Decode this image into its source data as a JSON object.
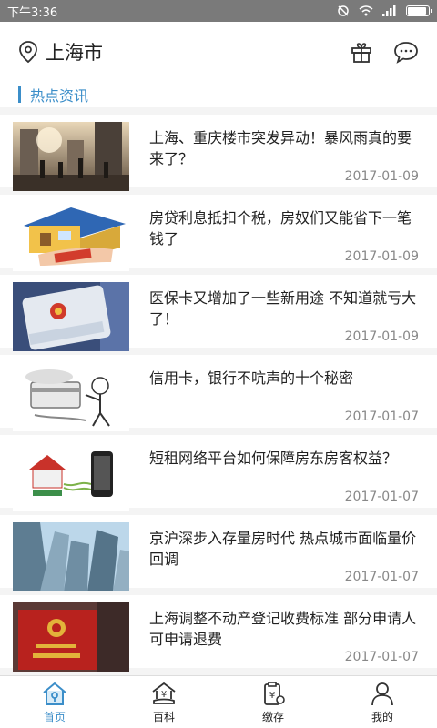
{
  "status": {
    "time": "下午3:36"
  },
  "header": {
    "city": "上海市"
  },
  "section": {
    "title": "热点资讯"
  },
  "news": [
    {
      "title": "上海、重庆楼市突发异动！暴风雨真的要来了？",
      "date": "2017-01-09"
    },
    {
      "title": "房贷利息抵扣个税，房奴们又能省下一笔钱了",
      "date": "2017-01-09"
    },
    {
      "title": "医保卡又增加了一些新用途 不知道就亏大了！",
      "date": "2017-01-09"
    },
    {
      "title": "信用卡，银行不吭声的十个秘密",
      "date": "2017-01-07"
    },
    {
      "title": "短租网络平台如何保障房东房客权益？",
      "date": "2017-01-07"
    },
    {
      "title": "京沪深步入存量房时代 热点城市面临量价回调",
      "date": "2017-01-07"
    },
    {
      "title": "上海调整不动产登记收费标准 部分申请人可申请退费",
      "date": "2017-01-07"
    }
  ],
  "tabs": [
    {
      "label": "首页",
      "icon": "home-icon",
      "active": true
    },
    {
      "label": "百科",
      "icon": "encyclopedia-icon"
    },
    {
      "label": "缴存",
      "icon": "deposit-icon"
    },
    {
      "label": "我的",
      "icon": "profile-icon"
    }
  ],
  "colors": {
    "accent": "#3b8ec9",
    "statusbar": "#7a7a7a"
  }
}
